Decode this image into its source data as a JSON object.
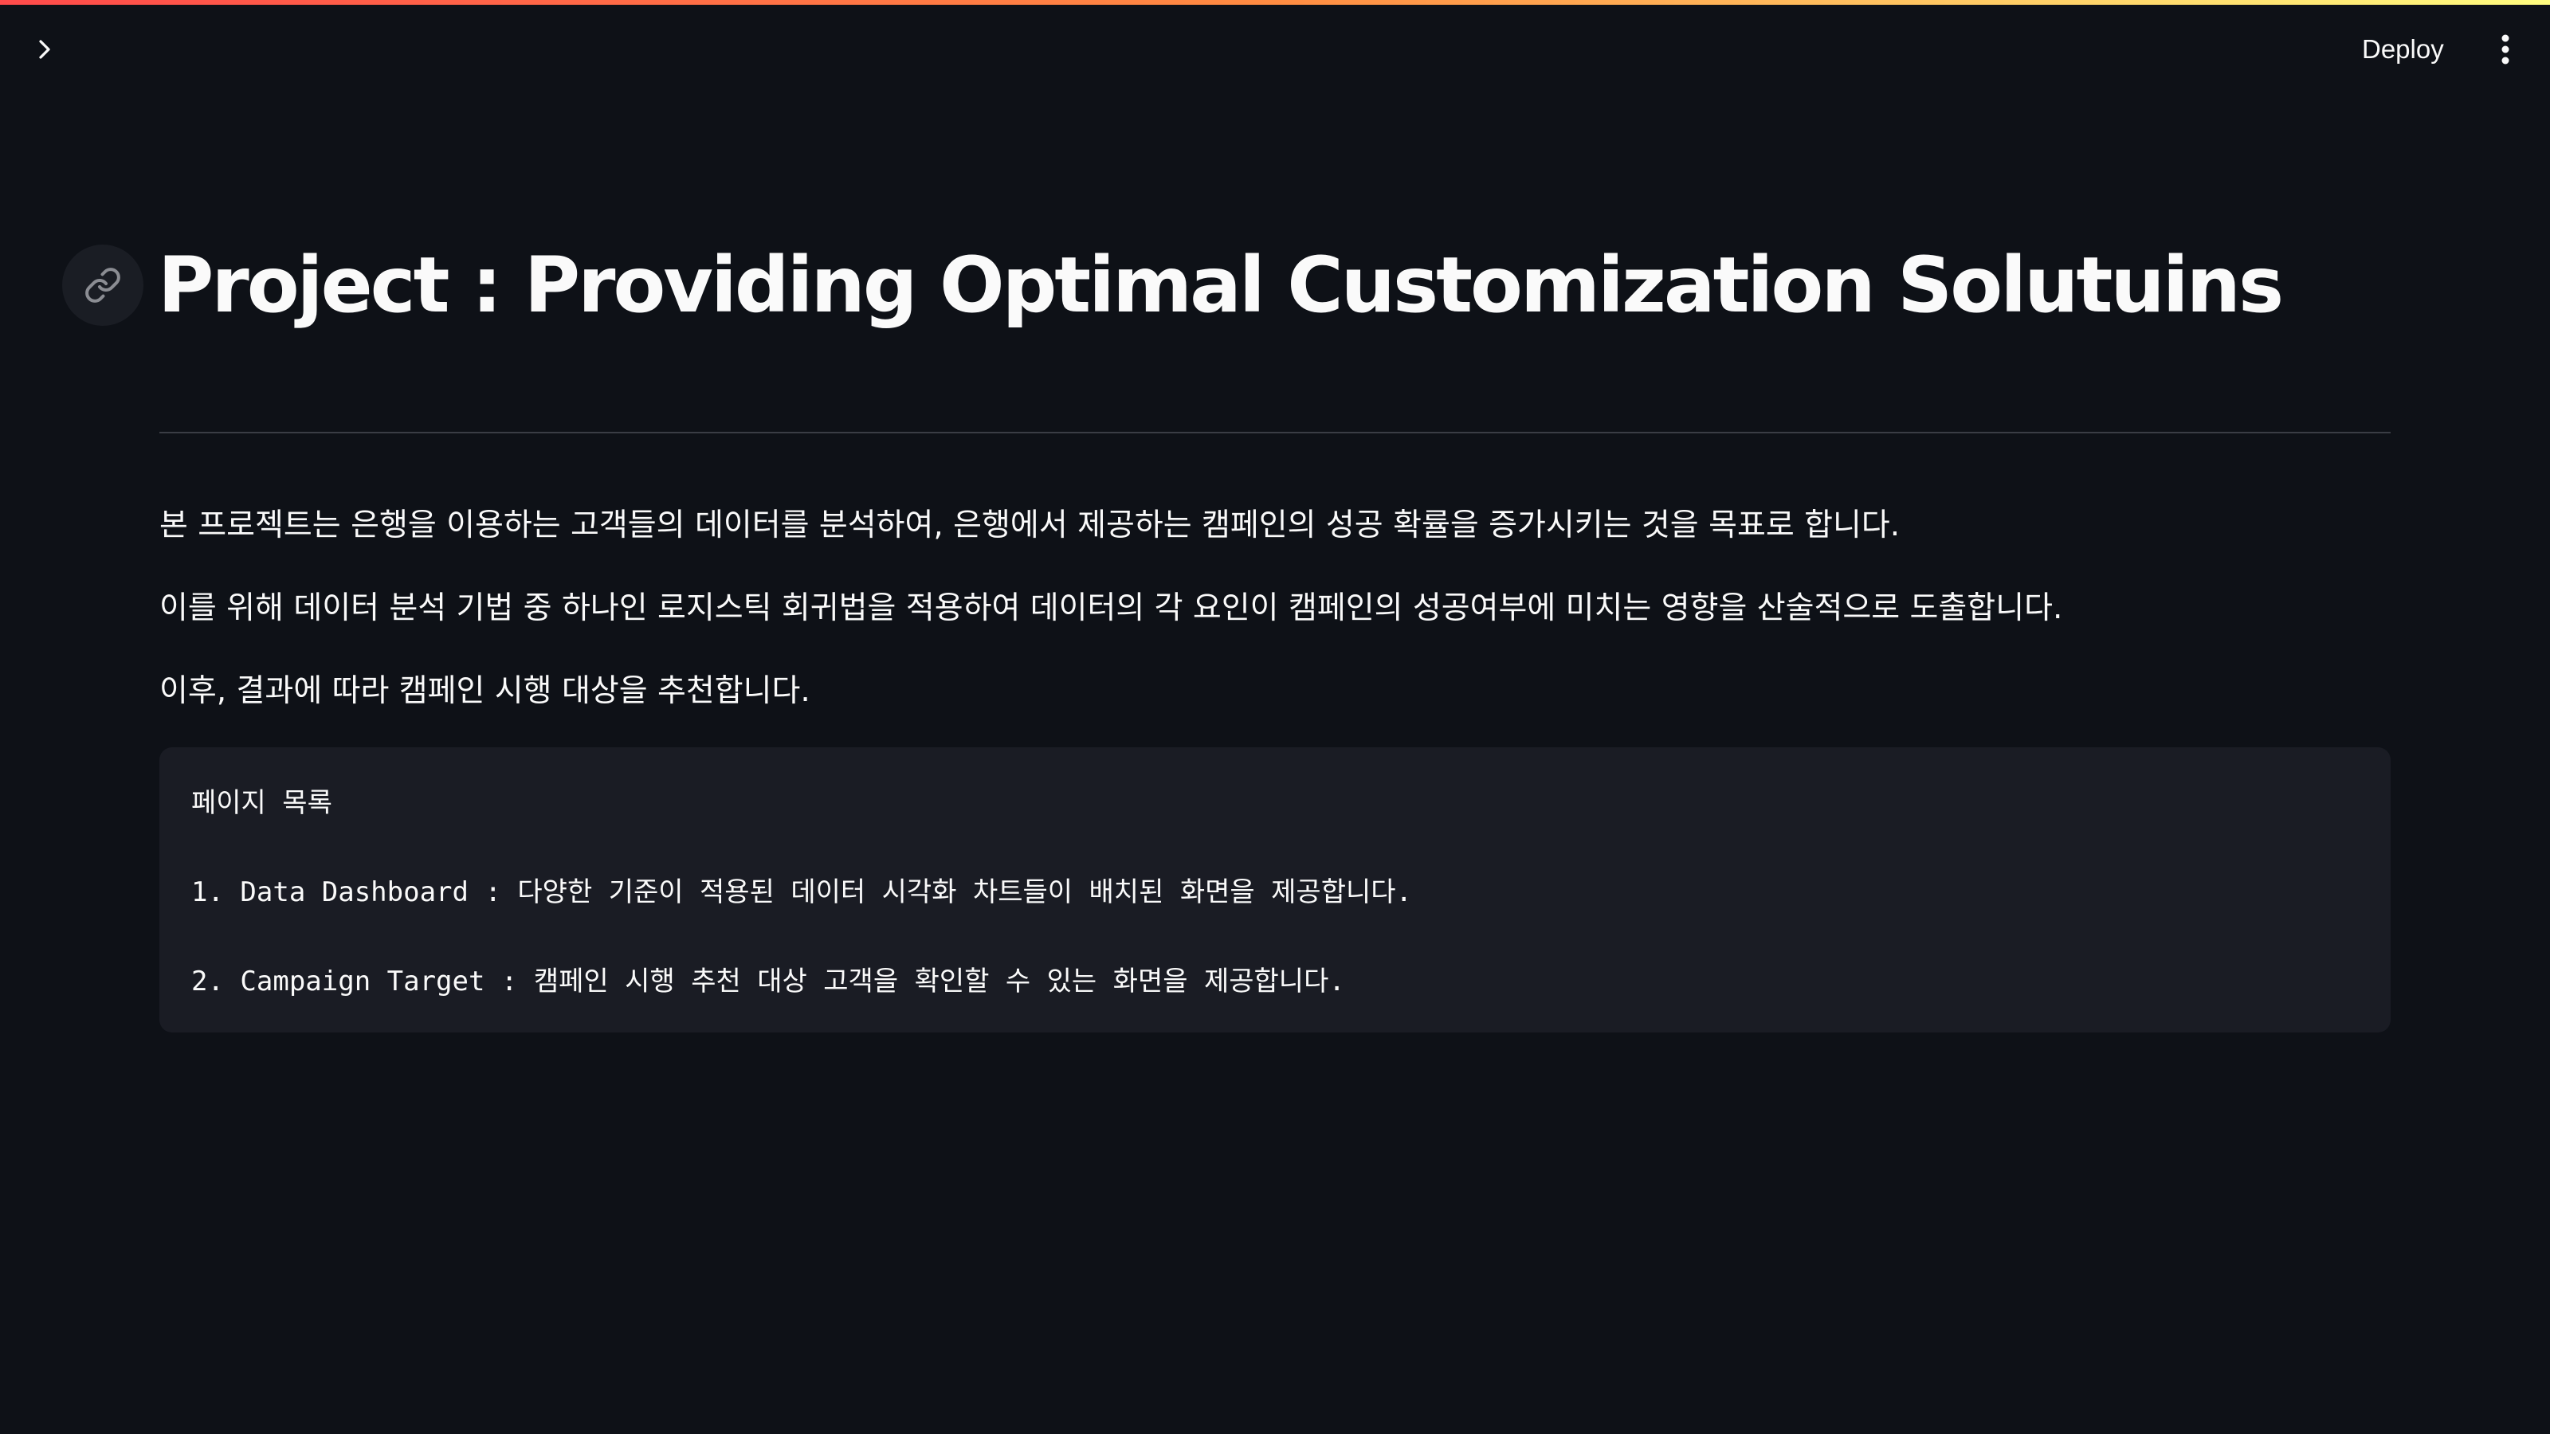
{
  "header": {
    "deploy_label": "Deploy",
    "sidebar_toggle_icon": "chevron-right-icon",
    "menu_icon": "vertical-ellipsis-icon"
  },
  "colors": {
    "background": "#0e1117",
    "text": "#fafafa",
    "code_background": "#1a1c24",
    "accent_gradient": [
      "#ff4b4b",
      "#ff8c42",
      "#fffd80"
    ]
  },
  "main": {
    "title": "Project : Providing Optimal Customization Solutuins",
    "anchor_icon": "link-icon",
    "paragraphs": [
      "본 프로젝트는 은행을 이용하는 고객들의 데이터를 분석하여, 은행에서 제공하는 캠페인의 성공 확률을 증가시키는 것을 목표로 합니다.",
      "이를 위해 데이터 분석 기법 중 하나인 로지스틱 회귀법을 적용하여 데이터의 각 요인이 캠페인의 성공여부에 미치는 영향을 산술적으로 도출합니다.",
      "이후, 결과에 따라 캠페인 시행 대상을 추천합니다."
    ],
    "code_block": {
      "lines": [
        "페이지 목록",
        "1. Data Dashboard : 다양한 기준이 적용된 데이터 시각화 차트들이 배치된 화면을 제공합니다.",
        "2. Campaign Target : 캠페인 시행 추천 대상 고객을 확인할 수 있는 화면을 제공합니다."
      ]
    }
  }
}
